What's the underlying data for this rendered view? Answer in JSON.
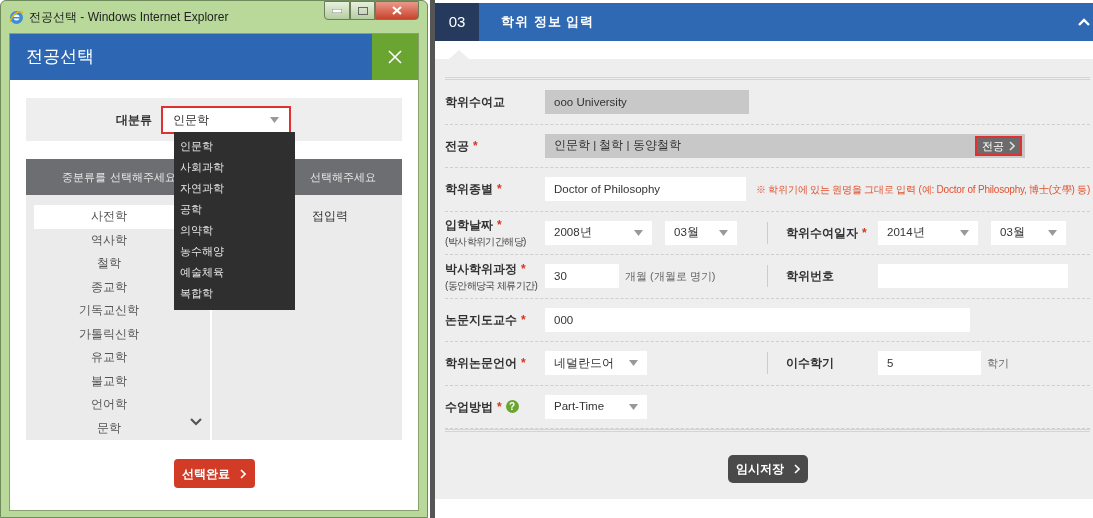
{
  "popup_window": {
    "title": "전공선택 - Windows Internet Explorer",
    "dialog_title": "전공선택",
    "category_label": "대분류",
    "category_value": "인문학",
    "category_options": [
      "인문학",
      "사회과학",
      "자연과학",
      "공학",
      "의약학",
      "농수해양",
      "예술체육",
      "복합학"
    ],
    "list_headers": [
      "중분류를 선택해주세요",
      "선택해주세요"
    ],
    "subcategories": [
      {
        "label": "사전학",
        "selected": true
      },
      {
        "label": "역사학",
        "selected": false
      },
      {
        "label": "철학",
        "selected": false
      },
      {
        "label": "종교학",
        "selected": false
      },
      {
        "label": "기독교신학",
        "selected": false
      },
      {
        "label": "가톨릭신학",
        "selected": false
      },
      {
        "label": "유교학",
        "selected": false
      },
      {
        "label": "불교학",
        "selected": false
      },
      {
        "label": "언어학",
        "selected": false
      },
      {
        "label": "문학",
        "selected": false
      }
    ],
    "right_column_text": "접입력",
    "confirm_button": "선택완료"
  },
  "section": {
    "step": "03",
    "title": "학위 정보 입력",
    "required_mark": "*",
    "rows": [
      {
        "groups": [
          {
            "label": "학위수여교",
            "required": false,
            "fields": [
              {
                "kind": "readonly",
                "value": "ooo University"
              }
            ]
          }
        ]
      },
      {
        "groups": [
          {
            "label": "전공",
            "required": true,
            "fields": [
              {
                "kind": "readonly",
                "value": "인문학 | 철학 | 동양철학",
                "button": "전공"
              }
            ]
          }
        ]
      },
      {
        "groups": [
          {
            "label": "학위종별",
            "required": true,
            "fields": [
              {
                "kind": "text",
                "value": "Doctor of Philosophy"
              }
            ]
          }
        ],
        "note": "※ 학위기에 있는 원명을 그대로 입력 (예: Doctor of Philosophy, 博士(文學) 등)"
      },
      {
        "groups": [
          {
            "label": "입학날짜",
            "sublabel": "(박사학위기간해당)",
            "required": true,
            "fields": [
              {
                "kind": "select",
                "value": "2008년"
              },
              {
                "kind": "select",
                "value": "03월"
              }
            ]
          },
          {
            "label": "학위수여일자",
            "required": true,
            "fields": [
              {
                "kind": "select",
                "value": "2014년"
              },
              {
                "kind": "select",
                "value": "03월"
              }
            ]
          }
        ]
      },
      {
        "groups": [
          {
            "label": "박사학위과정",
            "sublabel": "(동안해당국 체류기간)",
            "required": true,
            "fields": [
              {
                "kind": "text",
                "value": "30"
              }
            ],
            "suffix": "개월 (개월로 명기)"
          },
          {
            "label": "학위번호",
            "required": false,
            "fields": [
              {
                "kind": "text"
              }
            ]
          }
        ]
      },
      {
        "groups": [
          {
            "label": "논문지도교수",
            "required": true,
            "fields": [
              {
                "kind": "text",
                "value": "000"
              }
            ]
          }
        ]
      },
      {
        "groups": [
          {
            "label": "학위논문언어",
            "required": true,
            "fields": [
              {
                "kind": "select",
                "value": "네덜란드어"
              }
            ]
          },
          {
            "label": "이수학기",
            "required": false,
            "fields": [
              {
                "kind": "text",
                "value": "5"
              }
            ],
            "suffix": "학기"
          }
        ]
      },
      {
        "groups": [
          {
            "label": "수업방법",
            "required": true,
            "help": "?",
            "fields": [
              {
                "kind": "select",
                "value": "Part-Time"
              }
            ]
          }
        ]
      }
    ],
    "save_button": "임시저장"
  }
}
